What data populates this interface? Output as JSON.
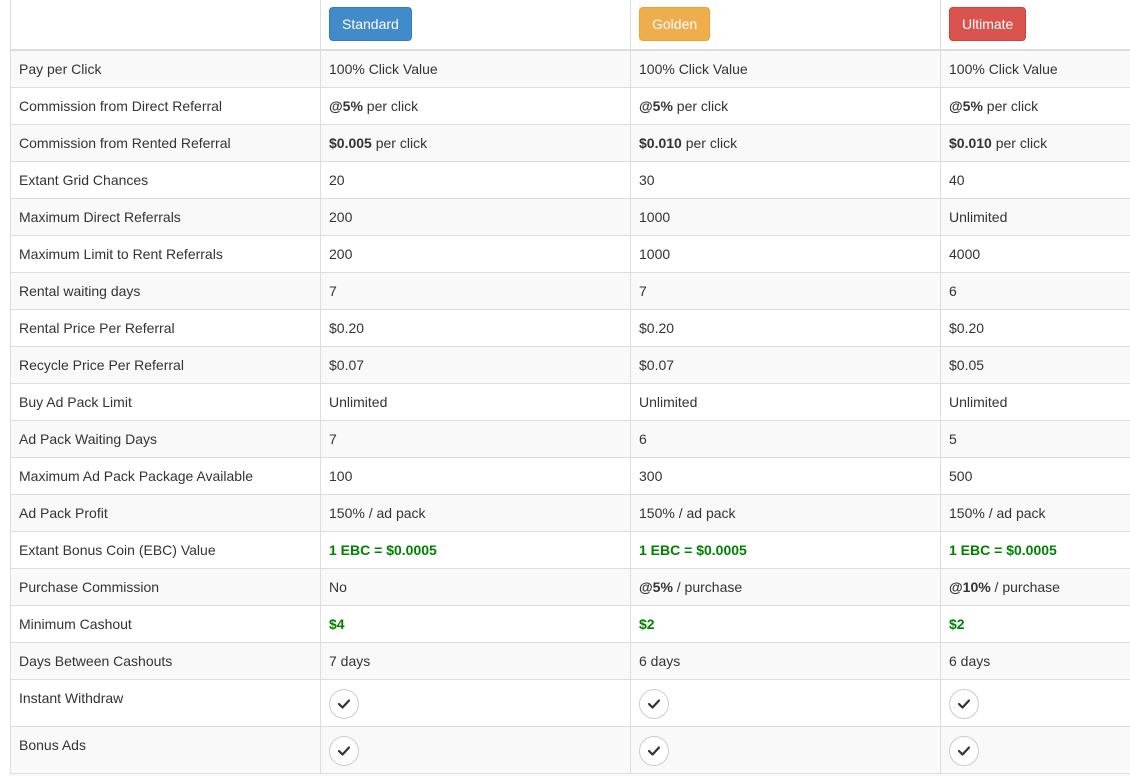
{
  "header": {
    "plans": [
      {
        "label": "Standard",
        "color": "#428bca"
      },
      {
        "label": "Golden",
        "color": "#f0ad4e"
      },
      {
        "label": "Ultimate",
        "color": "#d9534f"
      }
    ]
  },
  "rows": [
    {
      "label": "Pay per Click",
      "cells": [
        {
          "text": "100% Click Value"
        },
        {
          "text": "100% Click Value"
        },
        {
          "text": "100% Click Value"
        }
      ]
    },
    {
      "label": "Commission from Direct Referral",
      "cells": [
        {
          "bold": "@5%",
          "text": " per click"
        },
        {
          "bold": "@5%",
          "text": " per click"
        },
        {
          "bold": "@5%",
          "text": " per click"
        }
      ]
    },
    {
      "label": "Commission from Rented Referral",
      "cells": [
        {
          "bold": "$0.005",
          "text": " per click"
        },
        {
          "bold": "$0.010",
          "text": " per click"
        },
        {
          "bold": "$0.010",
          "text": " per click"
        }
      ]
    },
    {
      "label": "Extant Grid Chances",
      "cells": [
        {
          "text": "20"
        },
        {
          "text": "30"
        },
        {
          "text": "40"
        }
      ]
    },
    {
      "label": "Maximum Direct Referrals",
      "cells": [
        {
          "text": "200"
        },
        {
          "text": "1000"
        },
        {
          "text": "Unlimited"
        }
      ]
    },
    {
      "label": "Maximum Limit to Rent Referrals",
      "cells": [
        {
          "text": "200"
        },
        {
          "text": "1000"
        },
        {
          "text": "4000"
        }
      ]
    },
    {
      "label": "Rental waiting days",
      "cells": [
        {
          "text": "7"
        },
        {
          "text": "7"
        },
        {
          "text": "6"
        }
      ]
    },
    {
      "label": "Rental Price Per Referral",
      "cells": [
        {
          "text": "$0.20"
        },
        {
          "text": "$0.20"
        },
        {
          "text": "$0.20"
        }
      ]
    },
    {
      "label": "Recycle Price Per Referral",
      "cells": [
        {
          "text": "$0.07"
        },
        {
          "text": "$0.07"
        },
        {
          "text": "$0.05"
        }
      ]
    },
    {
      "label": "Buy Ad Pack Limit",
      "cells": [
        {
          "text": "Unlimited"
        },
        {
          "text": "Unlimited"
        },
        {
          "text": "Unlimited"
        }
      ]
    },
    {
      "label": "Ad Pack Waiting Days",
      "cells": [
        {
          "text": "7"
        },
        {
          "text": "6"
        },
        {
          "text": "5"
        }
      ]
    },
    {
      "label": "Maximum Ad Pack Package Available",
      "cells": [
        {
          "text": "100"
        },
        {
          "text": "300"
        },
        {
          "text": "500"
        }
      ]
    },
    {
      "label": "Ad Pack Profit",
      "cells": [
        {
          "text": "150% / ad pack"
        },
        {
          "text": "150% / ad pack"
        },
        {
          "text": "150% / ad pack"
        }
      ]
    },
    {
      "label": "Extant Bonus Coin (EBC) Value",
      "cells": [
        {
          "green": "1 EBC = $0.0005"
        },
        {
          "green": "1 EBC = $0.0005"
        },
        {
          "green": "1 EBC = $0.0005"
        }
      ]
    },
    {
      "label": "Purchase Commission",
      "cells": [
        {
          "text": "No"
        },
        {
          "bold": "@5%",
          "text": " / purchase"
        },
        {
          "bold": "@10%",
          "text": " / purchase"
        }
      ]
    },
    {
      "label": "Minimum Cashout",
      "cells": [
        {
          "green": "$4"
        },
        {
          "green": "$2"
        },
        {
          "green": "$2"
        }
      ]
    },
    {
      "label": "Days Between Cashouts",
      "cells": [
        {
          "text": "7 days"
        },
        {
          "text": "6 days"
        },
        {
          "text": "6 days"
        }
      ]
    },
    {
      "label": "Instant Withdraw",
      "cells": [
        {
          "icon": "check-icon"
        },
        {
          "icon": "check-icon"
        },
        {
          "icon": "check-icon"
        }
      ]
    },
    {
      "label": "Bonus Ads",
      "cells": [
        {
          "icon": "check-icon"
        },
        {
          "icon": "check-icon"
        },
        {
          "icon": "check-icon"
        }
      ]
    }
  ]
}
